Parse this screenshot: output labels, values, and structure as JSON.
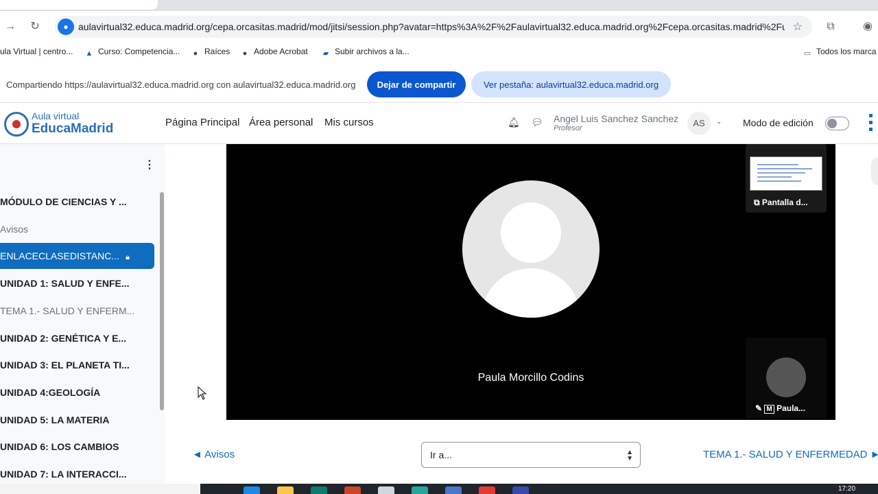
{
  "browser": {
    "url": "aulavirtual32.educa.madrid.org/cepa.orcasitas.madrid/mod/jitsi/session.php?avatar=https%3A%2F%2Faulavirtual32.educa.madrid.org%2Fcepa.orcasitas.madrid%2Fu...",
    "bookmarks": [
      {
        "label": "ula Virtual | centro..."
      },
      {
        "label": "Curso: Competencia..."
      },
      {
        "label": "Raíces"
      },
      {
        "label": "Adobe Acrobat"
      },
      {
        "label": "Subir archivos a la..."
      }
    ],
    "all_bookmarks": "Todos los marca"
  },
  "share_bar": {
    "message": "Compartiendo https://aulavirtual32.educa.madrid.org con aulavirtual32.educa.madrid.org",
    "stop_label": "Dejar de compartir",
    "view_tab_label": "Ver pestaña: aulavirtual32.educa.madrid.org"
  },
  "header": {
    "logo_line1": "Aula virtual",
    "logo_line2": "EducaMadrid",
    "nav": [
      "Página Principal",
      "Área personal",
      "Mis cursos"
    ],
    "user_name": "Angel Luis Sanchez Sanchez",
    "user_role": "Profesor",
    "avatar_initials": "AS",
    "edit_mode_label": "Modo de edición",
    "edit_mode_on": false
  },
  "sidebar": {
    "items": [
      {
        "label": "MÓDULO DE CIENCIAS Y ...",
        "style": "bold"
      },
      {
        "label": "Avisos",
        "style": "muted"
      },
      {
        "label": "ENLACECLASEDISTANC...",
        "style": "active"
      },
      {
        "label": "UNIDAD 1: SALUD Y ENFE...",
        "style": "bold"
      },
      {
        "label": "TEMA 1.- SALUD Y ENFERM...",
        "style": "muted"
      },
      {
        "label": "UNIDAD 2: GENÉTICA Y E...",
        "style": "bold"
      },
      {
        "label": "UNIDAD 3: EL PLANETA TI...",
        "style": "bold"
      },
      {
        "label": "UNIDAD 4:GEOLOGÍA",
        "style": "bold"
      },
      {
        "label": "UNIDAD 5: LA MATERIA",
        "style": "bold"
      },
      {
        "label": "UNIDAD 6: LOS CAMBIOS",
        "style": "bold"
      },
      {
        "label": "UNIDAD 7: LA INTERACCI...",
        "style": "bold"
      }
    ]
  },
  "meeting": {
    "participant_name": "Paula Morcillo Codins",
    "thumb_screen_label": "Pantalla d...",
    "thumb_participant_label": "Paula...",
    "thumb_participant_initial": "M"
  },
  "footer_nav": {
    "prev_label": "◄ Avisos",
    "jump_placeholder": "Ir a...",
    "next_label": "TEMA 1.- SALUD Y ENFERMEDAD ►"
  },
  "taskbar": {
    "time": "17:20"
  },
  "colors": {
    "moodle_blue": "#0f6cbf",
    "chrome_blue": "#0b57d0",
    "video_bg": "#000000"
  }
}
